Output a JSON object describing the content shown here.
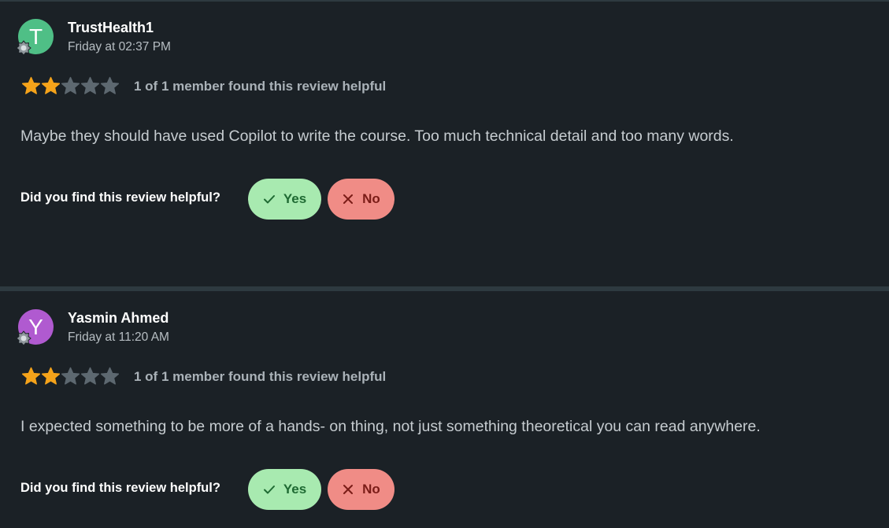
{
  "reviews": [
    {
      "avatar_letter": "T",
      "avatar_color": "#4fbf86",
      "author": "TrustHealth1",
      "date": "Friday at 02:37 PM",
      "rating": 2,
      "max_rating": 5,
      "helpful_count_text": "1 of 1 member found this review helpful",
      "text": "Maybe they should have used Copilot to write the course. Too much technical detail and too many words.",
      "helpful_prompt": "Did you find this review helpful?",
      "yes_label": "Yes",
      "no_label": "No"
    },
    {
      "avatar_letter": "Y",
      "avatar_color": "#b05ad0",
      "author": "Yasmin Ahmed",
      "date": "Friday at 11:20 AM",
      "rating": 2,
      "max_rating": 5,
      "helpful_count_text": "1 of 1 member found this review helpful",
      "text": "I expected something to be more of a hands- on thing, not just something theoretical you can read anywhere.",
      "helpful_prompt": "Did you find this review helpful?",
      "yes_label": "Yes",
      "no_label": "No"
    }
  ],
  "colors": {
    "star_filled": "#f5a31a",
    "star_empty": "#5d6870",
    "background": "#1b2126"
  },
  "icons": {
    "badge": "member-badge-icon",
    "yes": "check-icon",
    "no": "x-icon"
  }
}
